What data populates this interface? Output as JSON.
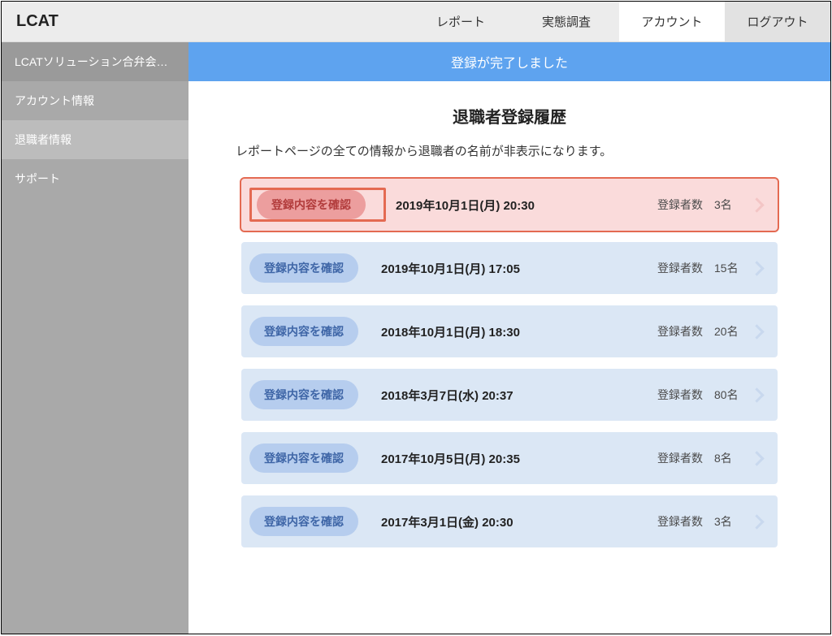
{
  "header": {
    "logo": "LCAT",
    "tabs": {
      "report": "レポート",
      "survey": "実態調査",
      "account": "アカウント",
      "logout": "ログアウト"
    }
  },
  "sidebar": {
    "org": "LCATソリューション合弁会…",
    "account_info": "アカウント情報",
    "retiree_info": "退職者情報",
    "support": "サポート"
  },
  "banner": "登録が完了しました",
  "page_title": "退職者登録履歴",
  "subtitle": "レポートページの全ての情報から退職者の名前が非表示になります。",
  "pill_label": "登録内容を確認",
  "count_label": "登録者数",
  "rows": [
    {
      "datetime": "2019年10月1日(月) 20:30",
      "count": "3名"
    },
    {
      "datetime": "2019年10月1日(月) 17:05",
      "count": "15名"
    },
    {
      "datetime": "2018年10月1日(月) 18:30",
      "count": "20名"
    },
    {
      "datetime": "2018年3月7日(水) 20:37",
      "count": "80名"
    },
    {
      "datetime": "2017年10月5日(月) 20:35",
      "count": "8名"
    },
    {
      "datetime": "2017年3月1日(金) 20:30",
      "count": "3名"
    }
  ]
}
